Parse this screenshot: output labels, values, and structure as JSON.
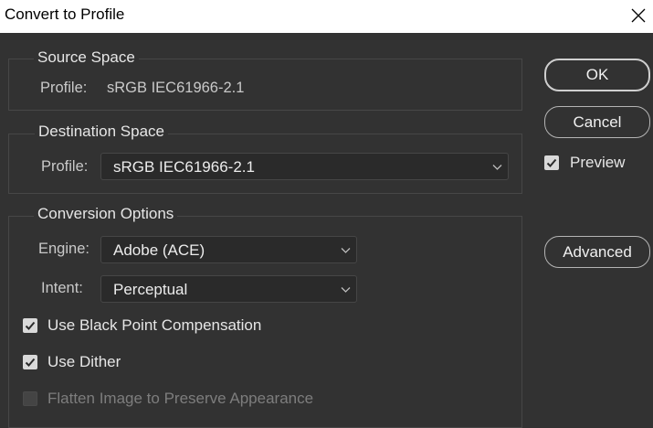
{
  "window": {
    "title": "Convert to Profile",
    "close_icon": "close-icon"
  },
  "source": {
    "legend": "Source Space",
    "profile_label": "Profile:",
    "profile_value": "sRGB IEC61966-2.1"
  },
  "destination": {
    "legend": "Destination Space",
    "profile_label": "Profile:",
    "profile_value": "sRGB IEC61966-2.1"
  },
  "options": {
    "legend": "Conversion Options",
    "engine_label": "Engine:",
    "engine_value": "Adobe (ACE)",
    "intent_label": "Intent:",
    "intent_value": "Perceptual",
    "black_point": {
      "label": "Use Black Point Compensation",
      "checked": true
    },
    "dither": {
      "label": "Use Dither",
      "checked": true
    },
    "flatten": {
      "label": "Flatten Image to Preserve Appearance",
      "checked": false,
      "disabled": true
    }
  },
  "buttons": {
    "ok": "OK",
    "cancel": "Cancel",
    "advanced": "Advanced"
  },
  "preview": {
    "label": "Preview",
    "checked": true
  },
  "colors": {
    "background": "#323232",
    "titlebar": "#ffffff",
    "field": "#2a2a2a",
    "text": "#e6e6e6"
  }
}
